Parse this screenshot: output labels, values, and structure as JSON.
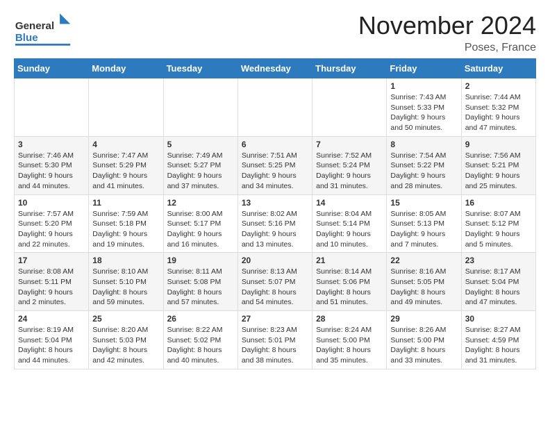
{
  "header": {
    "logo_general": "General",
    "logo_blue": "Blue",
    "month_title": "November 2024",
    "location": "Poses, France"
  },
  "weekdays": [
    "Sunday",
    "Monday",
    "Tuesday",
    "Wednesday",
    "Thursday",
    "Friday",
    "Saturday"
  ],
  "weeks": [
    [
      {
        "day": "",
        "info": ""
      },
      {
        "day": "",
        "info": ""
      },
      {
        "day": "",
        "info": ""
      },
      {
        "day": "",
        "info": ""
      },
      {
        "day": "",
        "info": ""
      },
      {
        "day": "1",
        "info": "Sunrise: 7:43 AM\nSunset: 5:33 PM\nDaylight: 9 hours\nand 50 minutes."
      },
      {
        "day": "2",
        "info": "Sunrise: 7:44 AM\nSunset: 5:32 PM\nDaylight: 9 hours\nand 47 minutes."
      }
    ],
    [
      {
        "day": "3",
        "info": "Sunrise: 7:46 AM\nSunset: 5:30 PM\nDaylight: 9 hours\nand 44 minutes."
      },
      {
        "day": "4",
        "info": "Sunrise: 7:47 AM\nSunset: 5:29 PM\nDaylight: 9 hours\nand 41 minutes."
      },
      {
        "day": "5",
        "info": "Sunrise: 7:49 AM\nSunset: 5:27 PM\nDaylight: 9 hours\nand 37 minutes."
      },
      {
        "day": "6",
        "info": "Sunrise: 7:51 AM\nSunset: 5:25 PM\nDaylight: 9 hours\nand 34 minutes."
      },
      {
        "day": "7",
        "info": "Sunrise: 7:52 AM\nSunset: 5:24 PM\nDaylight: 9 hours\nand 31 minutes."
      },
      {
        "day": "8",
        "info": "Sunrise: 7:54 AM\nSunset: 5:22 PM\nDaylight: 9 hours\nand 28 minutes."
      },
      {
        "day": "9",
        "info": "Sunrise: 7:56 AM\nSunset: 5:21 PM\nDaylight: 9 hours\nand 25 minutes."
      }
    ],
    [
      {
        "day": "10",
        "info": "Sunrise: 7:57 AM\nSunset: 5:20 PM\nDaylight: 9 hours\nand 22 minutes."
      },
      {
        "day": "11",
        "info": "Sunrise: 7:59 AM\nSunset: 5:18 PM\nDaylight: 9 hours\nand 19 minutes."
      },
      {
        "day": "12",
        "info": "Sunrise: 8:00 AM\nSunset: 5:17 PM\nDaylight: 9 hours\nand 16 minutes."
      },
      {
        "day": "13",
        "info": "Sunrise: 8:02 AM\nSunset: 5:16 PM\nDaylight: 9 hours\nand 13 minutes."
      },
      {
        "day": "14",
        "info": "Sunrise: 8:04 AM\nSunset: 5:14 PM\nDaylight: 9 hours\nand 10 minutes."
      },
      {
        "day": "15",
        "info": "Sunrise: 8:05 AM\nSunset: 5:13 PM\nDaylight: 9 hours\nand 7 minutes."
      },
      {
        "day": "16",
        "info": "Sunrise: 8:07 AM\nSunset: 5:12 PM\nDaylight: 9 hours\nand 5 minutes."
      }
    ],
    [
      {
        "day": "17",
        "info": "Sunrise: 8:08 AM\nSunset: 5:11 PM\nDaylight: 9 hours\nand 2 minutes."
      },
      {
        "day": "18",
        "info": "Sunrise: 8:10 AM\nSunset: 5:10 PM\nDaylight: 8 hours\nand 59 minutes."
      },
      {
        "day": "19",
        "info": "Sunrise: 8:11 AM\nSunset: 5:08 PM\nDaylight: 8 hours\nand 57 minutes."
      },
      {
        "day": "20",
        "info": "Sunrise: 8:13 AM\nSunset: 5:07 PM\nDaylight: 8 hours\nand 54 minutes."
      },
      {
        "day": "21",
        "info": "Sunrise: 8:14 AM\nSunset: 5:06 PM\nDaylight: 8 hours\nand 51 minutes."
      },
      {
        "day": "22",
        "info": "Sunrise: 8:16 AM\nSunset: 5:05 PM\nDaylight: 8 hours\nand 49 minutes."
      },
      {
        "day": "23",
        "info": "Sunrise: 8:17 AM\nSunset: 5:04 PM\nDaylight: 8 hours\nand 47 minutes."
      }
    ],
    [
      {
        "day": "24",
        "info": "Sunrise: 8:19 AM\nSunset: 5:04 PM\nDaylight: 8 hours\nand 44 minutes."
      },
      {
        "day": "25",
        "info": "Sunrise: 8:20 AM\nSunset: 5:03 PM\nDaylight: 8 hours\nand 42 minutes."
      },
      {
        "day": "26",
        "info": "Sunrise: 8:22 AM\nSunset: 5:02 PM\nDaylight: 8 hours\nand 40 minutes."
      },
      {
        "day": "27",
        "info": "Sunrise: 8:23 AM\nSunset: 5:01 PM\nDaylight: 8 hours\nand 38 minutes."
      },
      {
        "day": "28",
        "info": "Sunrise: 8:24 AM\nSunset: 5:00 PM\nDaylight: 8 hours\nand 35 minutes."
      },
      {
        "day": "29",
        "info": "Sunrise: 8:26 AM\nSunset: 5:00 PM\nDaylight: 8 hours\nand 33 minutes."
      },
      {
        "day": "30",
        "info": "Sunrise: 8:27 AM\nSunset: 4:59 PM\nDaylight: 8 hours\nand 31 minutes."
      }
    ]
  ]
}
